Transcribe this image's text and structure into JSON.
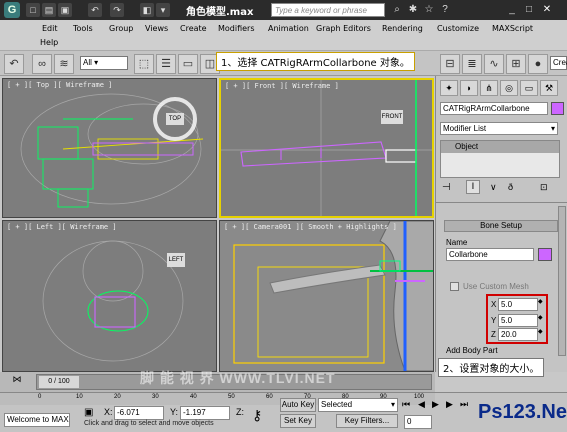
{
  "titlebar": {
    "title": "角色模型.max",
    "search_placeholder": "Type a keyword or phrase"
  },
  "menu": [
    "Edit",
    "Tools",
    "Group",
    "Views",
    "Create",
    "Modifiers",
    "Animation",
    "Graph Editors",
    "Rendering",
    "Customize",
    "MAXScript",
    "Help"
  ],
  "toolbar": {
    "selection_filter": "All",
    "create_field": "Crea"
  },
  "callouts": {
    "step1": "1、选择 CATRigRArmCollarbone 对象。",
    "step2": "2、设置对象的大小。"
  },
  "viewports": {
    "top": "[ + ][ Top ][ Wireframe ]",
    "top_cube": "TOP",
    "front": "[ + ][ Front ][ Wireframe ]",
    "front_cube": "FRONT",
    "left": "[ + ][ Left ][ Wireframe ]",
    "left_cube": "LEFT",
    "camera": "[ + ][ Camera001 ][ Smooth + Highlights ]"
  },
  "command_panel": {
    "object_name": "CATRigRArmCollarbone",
    "modifier_list": "Modifier List",
    "stack_item": "Object",
    "rollout_title": "Bone Setup",
    "name_label": "Name",
    "name_value": "Collarbone",
    "use_custom_mesh": "Use Custom Mesh",
    "x_label": "X",
    "x_value": "5.0",
    "y_label": "Y",
    "y_value": "5.0",
    "z_label": "Z",
    "z_value": "20.0",
    "add_body_part": "Add Body Part"
  },
  "timeline": {
    "frame_counter": "0 / 100",
    "ticks": [
      "0",
      "10",
      "20",
      "30",
      "40",
      "50",
      "60",
      "70",
      "80",
      "90",
      "100"
    ]
  },
  "status": {
    "maxscript": "Welcome to MAX",
    "prompt": "Click and drag to select and move objects",
    "x_label": "X:",
    "x_value": "-6.071",
    "y_label": "Y:",
    "y_value": "-1.197",
    "z_label": "Z:",
    "auto_key": "Auto Key",
    "set_key": "Set Key",
    "selected": "Selected",
    "key_filters": "Key Filters...",
    "frame": "0"
  },
  "watermarks": {
    "center": "脚 能 视 界  WWW.TLVI.NET",
    "corner": "Ps123.Net"
  },
  "colors": {
    "active_viewport": "#e6d200",
    "highlight": "#d00000",
    "bone_color": "#cc66ff"
  }
}
